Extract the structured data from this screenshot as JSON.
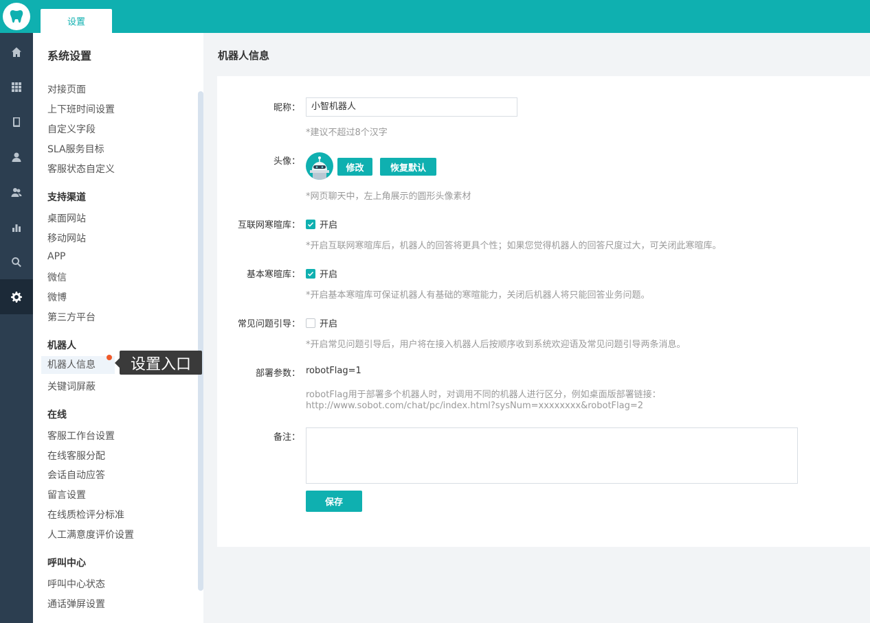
{
  "header": {
    "tab_label": "设置"
  },
  "menu": {
    "title": "系统设置",
    "groups": [
      {
        "items": [
          "对接页面",
          "上下班时间设置",
          "自定义字段",
          "SLA服务目标",
          "客服状态自定义"
        ]
      },
      {
        "title": "支持渠道",
        "items": [
          "桌面网站",
          "移动网站",
          "APP",
          "微信",
          "微博",
          "第三方平台"
        ]
      },
      {
        "title": "机器人",
        "items": [
          "机器人信息",
          "关键词屏蔽"
        ]
      },
      {
        "title": "在线",
        "items": [
          "客服工作台设置",
          "在线客服分配",
          "会话自动应答",
          "留言设置",
          "在线质检评分标准",
          "人工满意度评价设置"
        ]
      },
      {
        "title": "呼叫中心",
        "items": [
          "呼叫中心状态",
          "通话弹屏设置"
        ]
      }
    ],
    "tooltip": "设置入口"
  },
  "main": {
    "title": "机器人信息",
    "nickname": {
      "label": "昵称：",
      "value": "小智机器人",
      "hint": "*建议不超过8个汉字"
    },
    "avatar": {
      "label": "头像：",
      "modify_btn": "修改",
      "reset_btn": "恢复默认",
      "hint": "*网页聊天中，左上角展示的圆形头像素材"
    },
    "internet_greeting": {
      "label": "互联网寒暄库：",
      "checked": true,
      "option": "开启",
      "hint": "*开启互联网寒暄库后，机器人的回答将更具个性；如果您觉得机器人的回答尺度过大，可关闭此寒暄库。"
    },
    "basic_greeting": {
      "label": "基本寒暄库：",
      "checked": true,
      "option": "开启",
      "hint": "*开启基本寒暄库可保证机器人有基础的寒暄能力，关闭后机器人将只能回答业务问题。"
    },
    "faq_guide": {
      "label": "常见问题引导：",
      "checked": false,
      "option": "开启",
      "hint": "*开启常见问题引导后，用户将在接入机器人后按顺序收到系统欢迎语及常见问题引导两条消息。"
    },
    "deploy": {
      "label": "部署参数：",
      "value": "robotFlag=1",
      "hint_line1": "robotFlag用于部署多个机器人时，对调用不同的机器人进行区分，例如桌面版部署链接：",
      "hint_line2": "http://www.sobot.com/chat/pc/index.html?sysNum=xxxxxxxx&robotFlag=2"
    },
    "remark": {
      "label": "备注：",
      "value": ""
    },
    "save_btn": "保存"
  },
  "colors": {
    "accent": "#0fb0b0",
    "rail": "#2c3e50",
    "dot": "#f05a2a"
  }
}
